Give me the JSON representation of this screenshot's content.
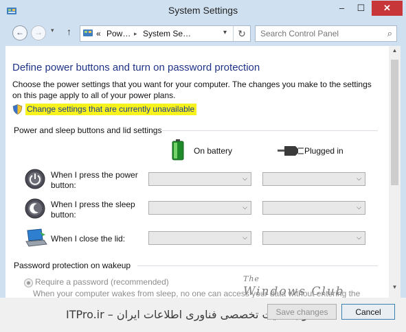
{
  "window": {
    "title": "System Settings",
    "min_glyph": "–",
    "max_glyph": "☐",
    "close_glyph": "✕"
  },
  "nav": {
    "back_glyph": "←",
    "forward_glyph": "→",
    "recent_glyph": "▾",
    "up_glyph": "↑",
    "breadcrumb": [
      "«",
      "Pow…",
      "System Se…"
    ],
    "separator": "▸",
    "refresh_glyph": "↻"
  },
  "search": {
    "placeholder": "Search Control Panel",
    "icon_glyph": "⌕"
  },
  "page": {
    "heading": "Define power buttons and turn on password protection",
    "description": "Choose the power settings that you want for your computer. The changes you make to the settings on this page apply to all of your power plans.",
    "change_link": "Change settings that are currently unavailable"
  },
  "power_section": {
    "title": "Power and sleep buttons and lid settings",
    "col_battery": "On battery",
    "col_plugged": "Plugged in",
    "rows": [
      {
        "label": "When I press the power button:",
        "battery_value": "",
        "plugged_value": ""
      },
      {
        "label": "When I press the sleep button:",
        "battery_value": "",
        "plugged_value": ""
      },
      {
        "label": "When I close the lid:",
        "battery_value": "",
        "plugged_value": ""
      }
    ],
    "dropdown_glyph": "⌵"
  },
  "password_section": {
    "title": "Password protection on wakeup",
    "option_require": "Require a password (recommended)",
    "cutoff_text": "When your computer wakes from sleep, no one can access your data without entering the"
  },
  "footer": {
    "save_label": "Save changes",
    "cancel_label": "Cancel"
  },
  "watermarks": {
    "logo_line1": "The",
    "logo_line2": "Windows Club",
    "persian": "ITPro.ir – وب سایت تخصصی فناوری اطلاعات ایران"
  },
  "colors": {
    "heading": "#1e3287",
    "link_highlight": "#f8f31c",
    "close_button": "#c7373a",
    "frame": "#cfe0f1"
  },
  "icons": [
    "control-panel-icon",
    "shield-icon",
    "battery-icon",
    "plug-icon",
    "power-button-icon",
    "sleep-button-icon",
    "laptop-lid-icon",
    "search-icon",
    "refresh-icon"
  ]
}
